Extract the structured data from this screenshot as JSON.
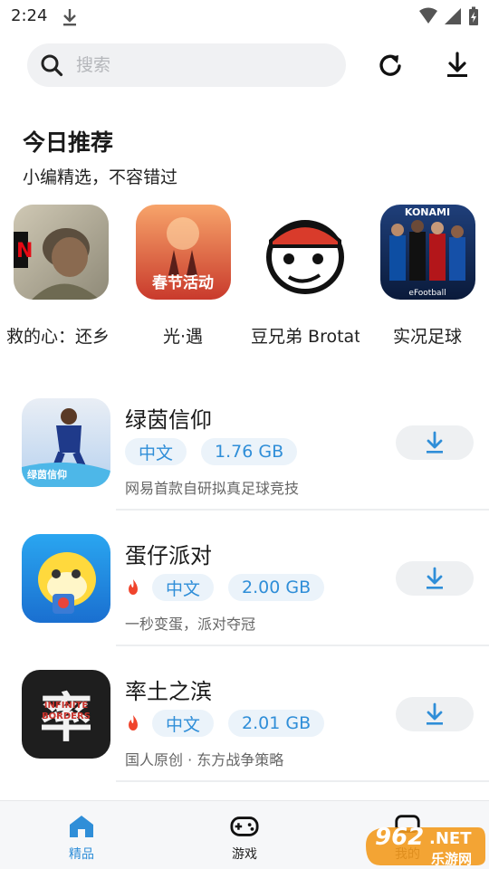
{
  "status_bar": {
    "time": "2:24"
  },
  "search": {
    "placeholder": "搜索"
  },
  "section": {
    "title": "今日推荐",
    "subtitle": "小编精选，不容错过"
  },
  "carousel": [
    {
      "label": "救的心：还乡"
    },
    {
      "label": "光·遇",
      "icon_text": "春节活动"
    },
    {
      "label": "豆兄弟 Brotat"
    },
    {
      "label": "实况足球",
      "icon_text": "KONAMI",
      "icon_sub": "eFootball"
    }
  ],
  "apps": [
    {
      "name": "绿茵信仰",
      "hot": false,
      "lang": "中文",
      "size": "1.76 GB",
      "desc": "网易首款自研拟真足球竞技",
      "icon_text": "绿茵信仰"
    },
    {
      "name": "蛋仔派对",
      "hot": true,
      "lang": "中文",
      "size": "2.00 GB",
      "desc": "一秒变蛋，派对夺冠"
    },
    {
      "name": "率土之滨",
      "hot": true,
      "lang": "中文",
      "size": "2.01 GB",
      "desc": "国人原创 · 东方战争策略",
      "icon_text": "率",
      "icon_sub": "INFINITE BORDERS"
    }
  ],
  "tabs": [
    {
      "label": "精品",
      "active": true
    },
    {
      "label": "游戏",
      "active": false
    },
    {
      "label": "我的",
      "active": false
    }
  ],
  "watermark": {
    "number": "962",
    "net": ".NET",
    "site": "乐游网"
  },
  "colors": {
    "accent": "#2f8ed8",
    "tag_bg": "#ebf3fa",
    "fire": "#f0442c"
  }
}
